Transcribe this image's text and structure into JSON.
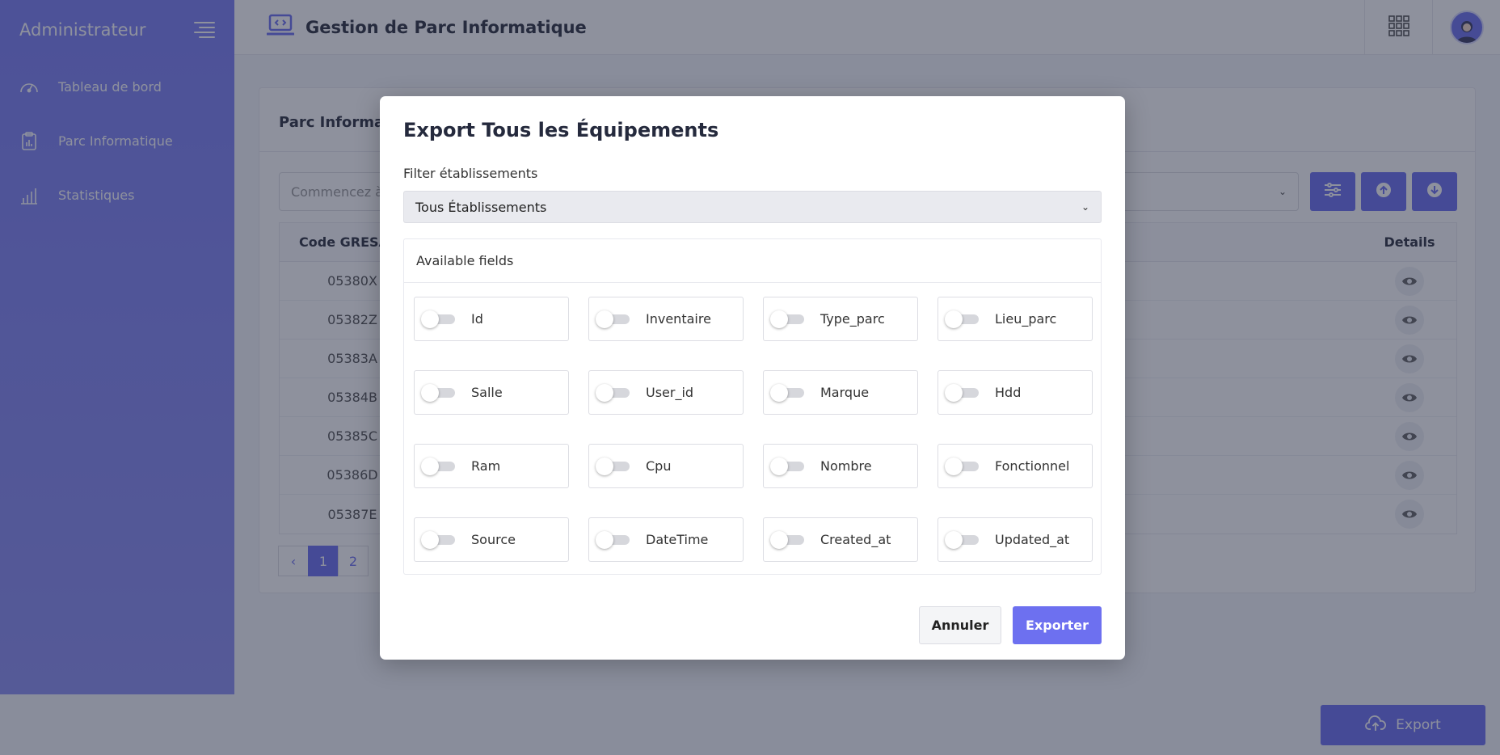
{
  "sidebar": {
    "title": "Administrateur",
    "items": [
      {
        "label": "Tableau de bord",
        "icon": "gauge-icon"
      },
      {
        "label": "Parc Informatique",
        "icon": "clipboard-chart-icon"
      },
      {
        "label": "Statistiques",
        "icon": "bar-chart-icon"
      }
    ]
  },
  "topbar": {
    "title": "Gestion de Parc Informatique",
    "brand_icon": "laptop-code-icon",
    "apps_icon": "grid-icon",
    "avatar_icon": "user-avatar-icon"
  },
  "main": {
    "card_title": "Parc Informat",
    "search_placeholder": "Commencez à",
    "table": {
      "headers": {
        "code": "Code GRESA",
        "details": "Details"
      },
      "rows": [
        "05380X",
        "05382Z",
        "05383A",
        "05384B",
        "05385C",
        "05386D",
        "05387E"
      ]
    },
    "pagination": {
      "prev": "‹",
      "pages": [
        "1",
        "2"
      ]
    },
    "export_button": "Export"
  },
  "modal": {
    "title": "Export Tous les Équipements",
    "filter_label": "Filter établissements",
    "filter_value": "Tous Établissements",
    "fields_title": "Available fields",
    "fields": [
      {
        "label": "Id",
        "enabled": false
      },
      {
        "label": "Inventaire",
        "enabled": false
      },
      {
        "label": "Type_parc",
        "enabled": false
      },
      {
        "label": "Lieu_parc",
        "enabled": false
      },
      {
        "label": "Salle",
        "enabled": false
      },
      {
        "label": "User_id",
        "enabled": false
      },
      {
        "label": "Marque",
        "enabled": false
      },
      {
        "label": "Hdd",
        "enabled": false
      },
      {
        "label": "Ram",
        "enabled": false
      },
      {
        "label": "Cpu",
        "enabled": false
      },
      {
        "label": "Nombre",
        "enabled": false
      },
      {
        "label": "Fonctionnel",
        "enabled": false
      },
      {
        "label": "Source",
        "enabled": false
      },
      {
        "label": "DateTime",
        "enabled": false
      },
      {
        "label": "Created_at",
        "enabled": false
      },
      {
        "label": "Updated_at",
        "enabled": false
      }
    ],
    "cancel_label": "Annuler",
    "export_label": "Exporter"
  },
  "colors": {
    "accent": "#6d70f0",
    "sidebar": "#7c80f5",
    "backdrop": "rgba(30,36,60,0.5)"
  }
}
